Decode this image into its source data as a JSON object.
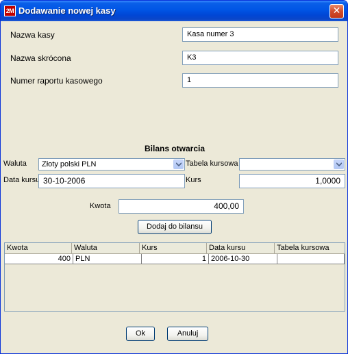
{
  "window": {
    "app_icon_text": "2M",
    "title": "Dodawanie nowej kasy",
    "close_glyph": "✕"
  },
  "form": {
    "name_label": "Nazwa kasy",
    "name_value": "Kasa numer 3",
    "short_name_label": "Nazwa skrócona",
    "short_name_value": "K3",
    "report_number_label": "Numer raportu kasowego",
    "report_number_value": "1"
  },
  "balance": {
    "title": "Bilans otwarcia",
    "currency_label": "Waluta",
    "currency_value": "Złoty polski PLN",
    "rate_table_label": "Tabela kursowa",
    "rate_table_value": "",
    "rate_date_label": "Data kursu",
    "rate_date_value": "30-10-2006",
    "rate_label": "Kurs",
    "rate_value": "1,0000",
    "amount_label": "Kwota",
    "amount_value": "400,00",
    "add_button": "Dodaj do bilansu"
  },
  "table": {
    "columns": [
      "Kwota",
      "Waluta",
      "Kurs",
      "Data kursu",
      "Tabela kursowa"
    ],
    "rows": [
      [
        "400",
        "PLN",
        "1",
        "2006-10-30",
        ""
      ]
    ]
  },
  "footer": {
    "ok_button": "Ok",
    "cancel_button": "Anuluj"
  }
}
